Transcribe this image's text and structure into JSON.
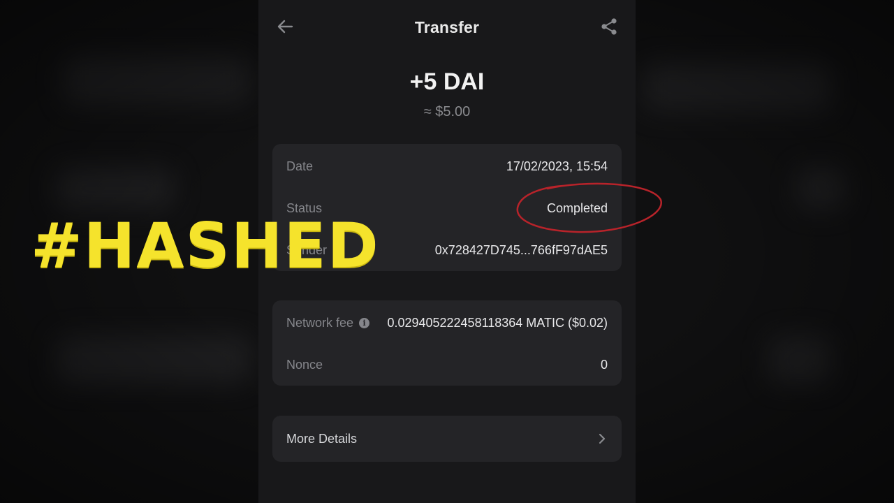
{
  "header": {
    "title": "Transfer",
    "back_icon": "arrow-left-icon",
    "share_icon": "share-icon"
  },
  "summary": {
    "amount": "+5 DAI",
    "fiat": "≈ $5.00"
  },
  "details": {
    "date_label": "Date",
    "date_value": "17/02/2023, 15:54",
    "status_label": "Status",
    "status_value": "Completed",
    "sender_label": "Sender",
    "sender_value": "0x728427D745...766fF97dAE5"
  },
  "fees": {
    "network_fee_label": "Network fee",
    "network_fee_value": "0.029405222458118364 MATIC ($0.02)",
    "info_icon": "info-icon",
    "nonce_label": "Nonce",
    "nonce_value": "0"
  },
  "more": {
    "label": "More Details",
    "chevron_icon": "chevron-right-icon"
  },
  "overlay": {
    "hashtag": "#HASHED"
  },
  "colors": {
    "background": "#101011",
    "screen": "#18181a",
    "card": "#242427",
    "muted_text": "#85868b",
    "primary_text": "#e8e8ea",
    "annotation": "#b8232a",
    "hashtag": "#f5e32c"
  }
}
